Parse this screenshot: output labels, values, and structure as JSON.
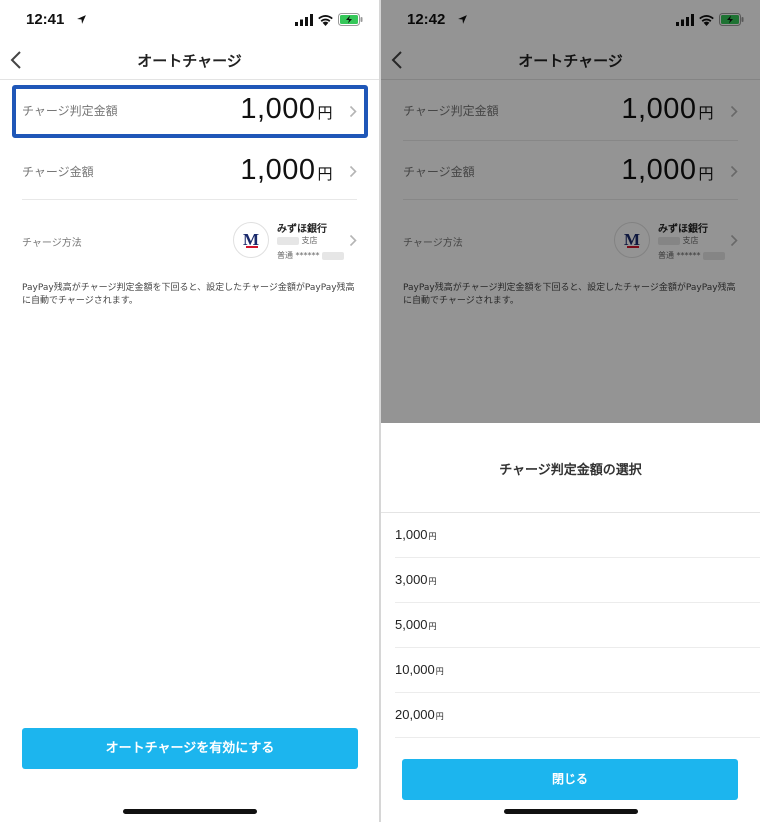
{
  "left": {
    "status": {
      "time": "12:41"
    },
    "nav": {
      "title": "オートチャージ"
    },
    "threshold": {
      "label": "チャージ判定金額",
      "amount": "1,000",
      "unit": "円"
    },
    "charge": {
      "label": "チャージ金額",
      "amount": "1,000",
      "unit": "円"
    },
    "method": {
      "label": "チャージ方法",
      "bank_logo": "M",
      "bank_name": "みずほ銀行",
      "branch": "支店",
      "account": "普通 ******"
    },
    "description": "PayPay残高がチャージ判定金額を下回ると、設定したチャージ金額がPayPay残高に自動でチャージされます。",
    "enable_button": "オートチャージを有効にする"
  },
  "right": {
    "status": {
      "time": "12:42"
    },
    "nav": {
      "title": "オートチャージ"
    },
    "threshold": {
      "label": "チャージ判定金額",
      "amount": "1,000",
      "unit": "円"
    },
    "charge": {
      "label": "チャージ金額",
      "amount": "1,000",
      "unit": "円"
    },
    "method": {
      "label": "チャージ方法",
      "bank_logo": "M",
      "bank_name": "みずほ銀行",
      "branch": "支店",
      "account": "普通 ******"
    },
    "description": "PayPay残高がチャージ判定金額を下回ると、設定したチャージ金額がPayPay残高に自動でチャージされます。",
    "sheet": {
      "title": "チャージ判定金額の選択",
      "options": [
        {
          "amount": "1,000",
          "unit": "円"
        },
        {
          "amount": "3,000",
          "unit": "円"
        },
        {
          "amount": "5,000",
          "unit": "円"
        },
        {
          "amount": "10,000",
          "unit": "円"
        },
        {
          "amount": "20,000",
          "unit": "円"
        }
      ],
      "close_button": "閉じる"
    }
  },
  "colors": {
    "accent": "#1cb5ee",
    "highlight_border": "#1f57b8",
    "battery_green": "#35c759",
    "bank_navy": "#1a2a6c",
    "bank_red": "#d0142c"
  },
  "icons": [
    "location-arrow-icon",
    "signal-icon",
    "wifi-icon",
    "battery-charging-icon",
    "back-chevron-icon",
    "chevron-right-icon",
    "mizuho-logo"
  ]
}
